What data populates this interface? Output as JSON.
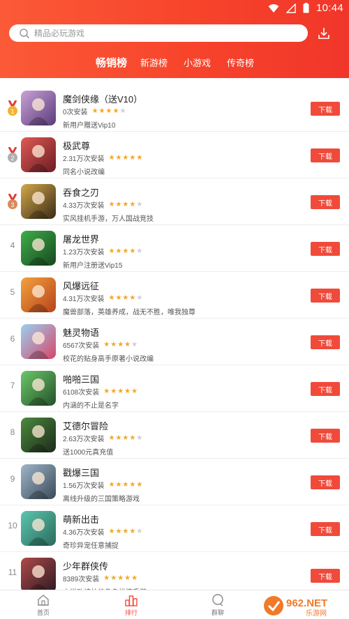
{
  "status": {
    "time": "10:44"
  },
  "search": {
    "placeholder": "精品必玩游戏"
  },
  "tabs": [
    {
      "label": "畅销榜",
      "active": true
    },
    {
      "label": "新游榜",
      "active": false
    },
    {
      "label": "小游戏",
      "active": false
    },
    {
      "label": "传奇榜",
      "active": false
    }
  ],
  "download_label": "下载",
  "games": [
    {
      "rank": "1",
      "name": "魔剑侠缘（送V10）",
      "installs": "0次安装",
      "rating": 4,
      "desc": "新用户赠送Vip10",
      "icon_colors": [
        "#c9a2d8",
        "#5a3b7a"
      ]
    },
    {
      "rank": "2",
      "name": "极武尊",
      "installs": "2.31万次安装",
      "rating": 5,
      "desc": "同名小说改编",
      "icon_colors": [
        "#e05a55",
        "#6b1c24"
      ]
    },
    {
      "rank": "3",
      "name": "吞食之刃",
      "installs": "4.33万次安装",
      "rating": 4,
      "desc": "实风挂机手游，万人国战竞技",
      "icon_colors": [
        "#d4a84a",
        "#3a2a18"
      ]
    },
    {
      "rank": "4",
      "name": "屠龙世界",
      "installs": "1.23万次安装",
      "rating": 4,
      "desc": "新用户注册送Vip15",
      "icon_colors": [
        "#3fae4a",
        "#17481f"
      ]
    },
    {
      "rank": "5",
      "name": "风爆远征",
      "installs": "4.31万次安装",
      "rating": 4,
      "desc": "魔兽部落，英雄养成，战无不胜，唯我独尊",
      "icon_colors": [
        "#f2a23c",
        "#b8421c"
      ]
    },
    {
      "rank": "6",
      "name": "魅灵物语",
      "installs": "6567次安装",
      "rating": 4,
      "desc": "校花的贴身高手原著小说改编",
      "icon_colors": [
        "#9ad0f0",
        "#d8466a"
      ]
    },
    {
      "rank": "7",
      "name": "啪啪三国",
      "installs": "6108次安装",
      "rating": 5,
      "desc": "内涵的不止是名字",
      "icon_colors": [
        "#6cc86a",
        "#24512a"
      ]
    },
    {
      "rank": "8",
      "name": "艾德尔冒险",
      "installs": "2.63万次安装",
      "rating": 4,
      "desc": "送1000元真充值",
      "icon_colors": [
        "#4c8a3e",
        "#1d2a1a"
      ]
    },
    {
      "rank": "9",
      "name": "戳爆三国",
      "installs": "1.56万次安装",
      "rating": 5,
      "desc": "离线升级的三国策略游戏",
      "icon_colors": [
        "#9eb6c8",
        "#3b4a5a"
      ]
    },
    {
      "rank": "10",
      "name": "萌新出击",
      "installs": "4.36万次安装",
      "rating": 4,
      "desc": "奇珍异宠任意捕捉",
      "icon_colors": [
        "#5cc6b0",
        "#2a6b5a"
      ]
    },
    {
      "rank": "11",
      "name": "少年群侠传",
      "installs": "8389次安装",
      "rating": 5,
      "desc": "小说改编仙侠角色扮演手游",
      "icon_colors": [
        "#b04a4a",
        "#2c1a22"
      ]
    }
  ],
  "nav": [
    {
      "label": "首页",
      "icon": "home-icon",
      "active": false
    },
    {
      "label": "排行",
      "icon": "ranking-icon",
      "active": true
    },
    {
      "label": "群聊",
      "icon": "chat-icon",
      "active": false
    }
  ],
  "watermark": {
    "brand": "962.NET",
    "sub": "乐游网"
  },
  "colors": {
    "accent": "#f04a3a",
    "header_start": "#fb5a38",
    "header_end": "#f0362a",
    "star": "#f5a623"
  }
}
